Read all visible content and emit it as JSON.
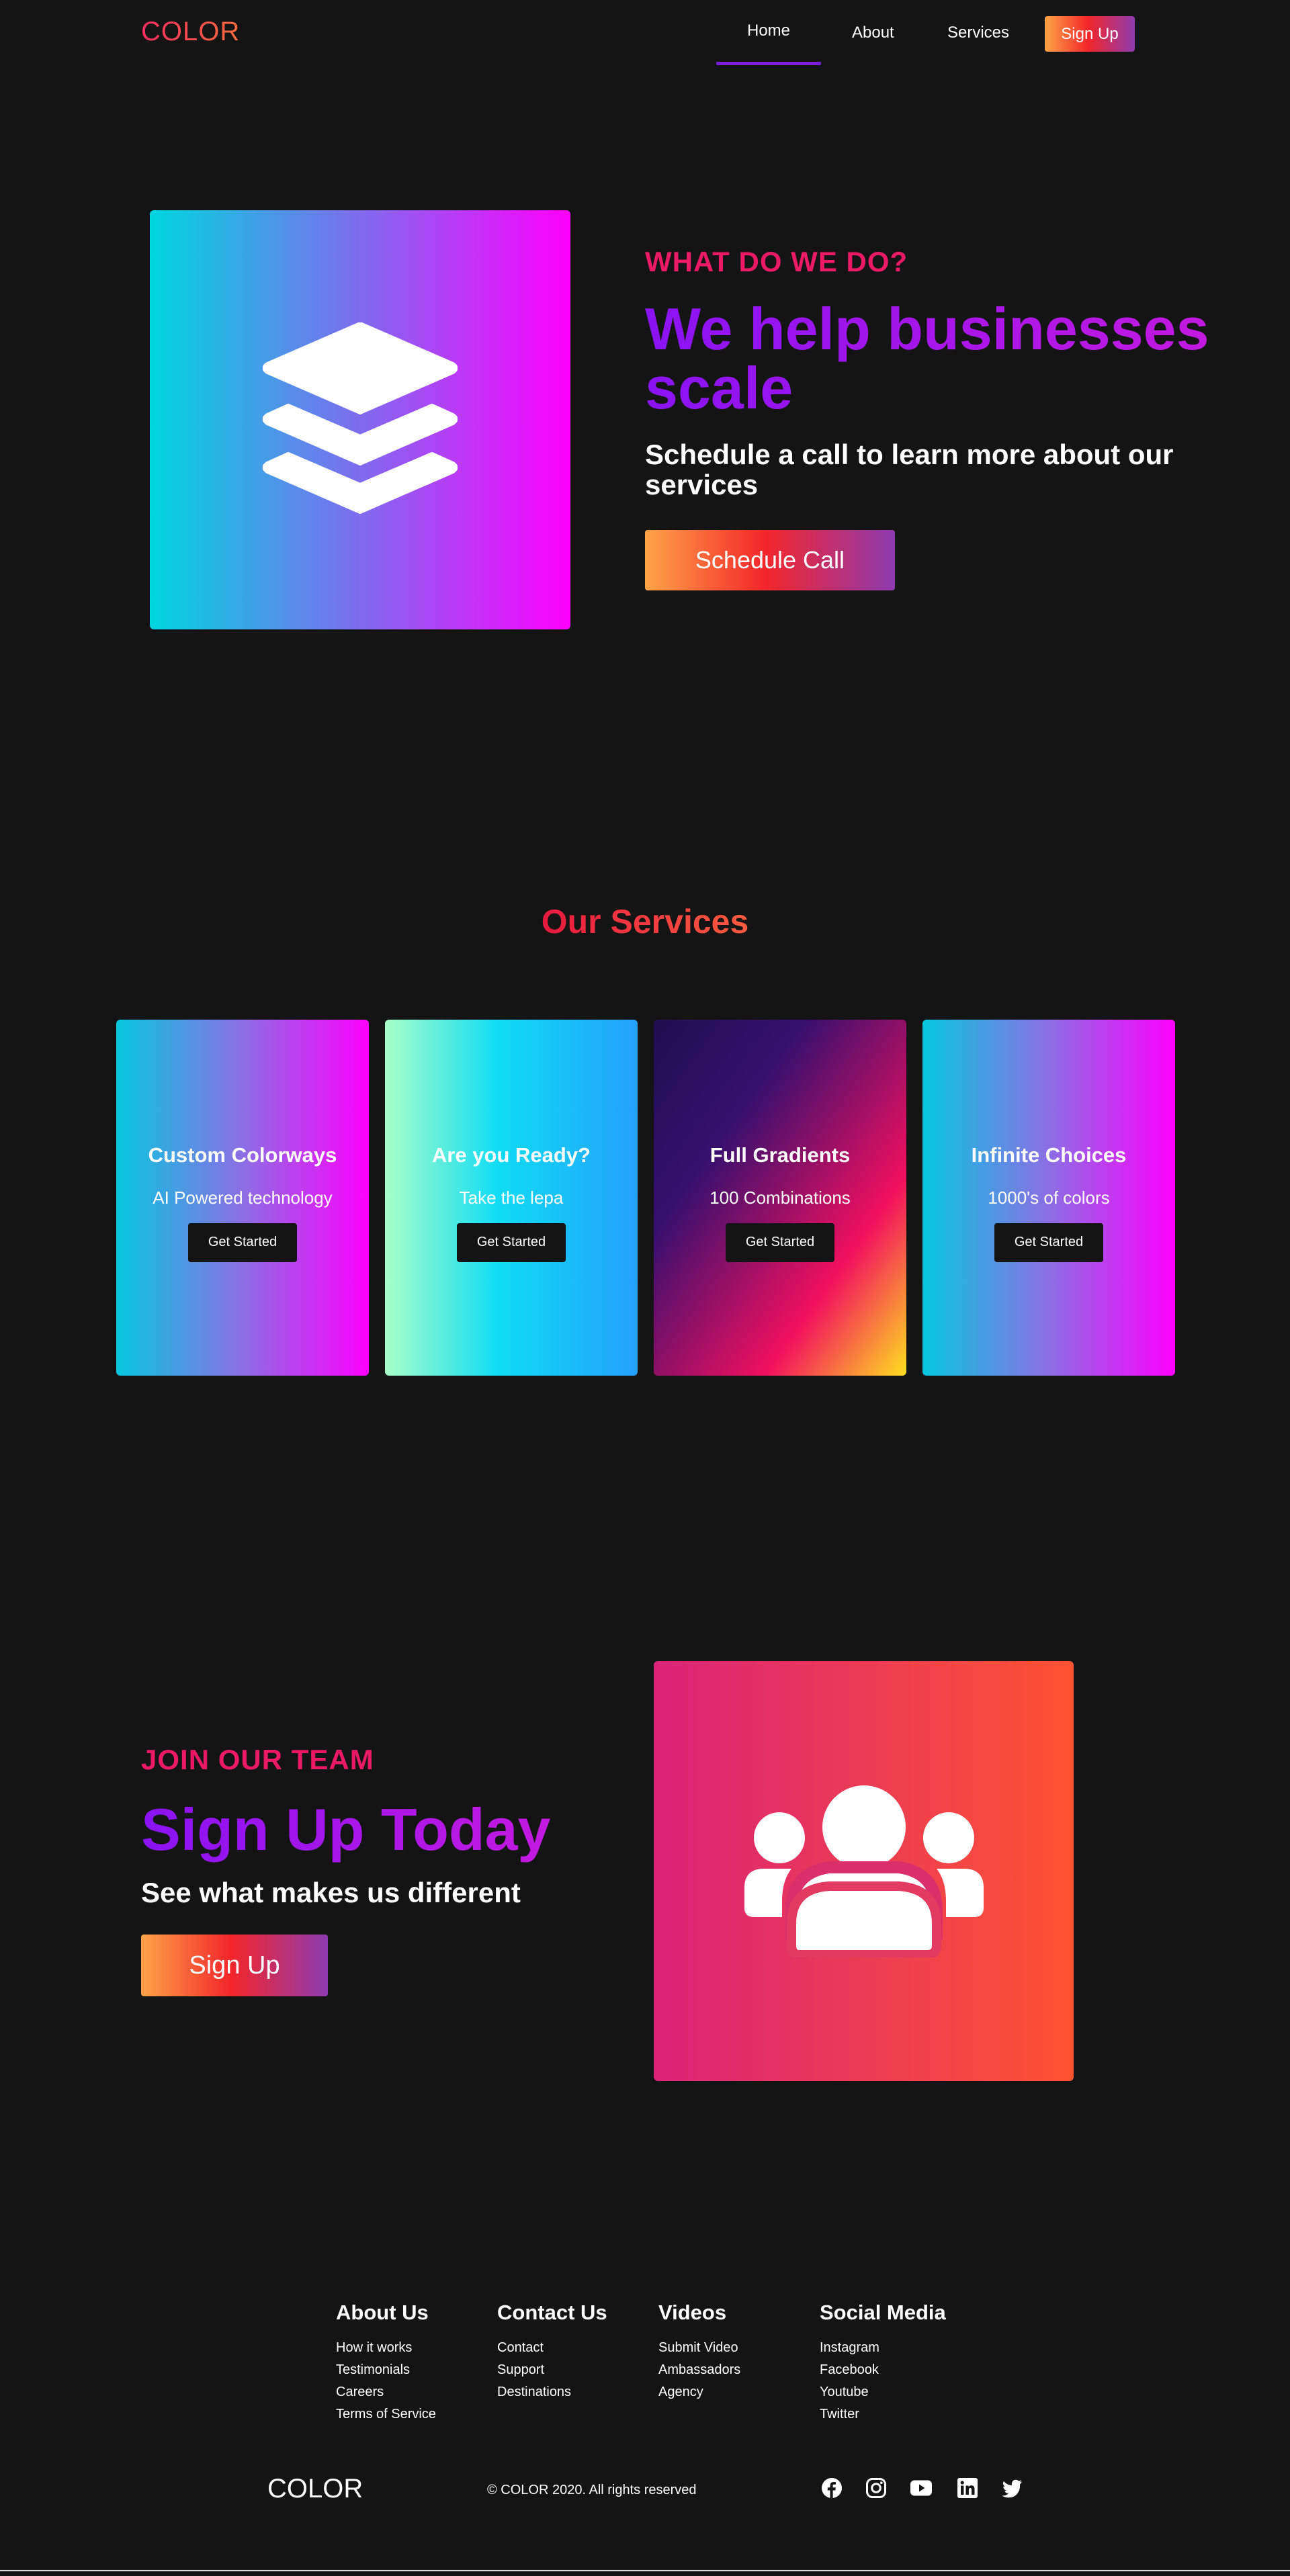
{
  "nav": {
    "logo": "COLOR",
    "links": [
      {
        "label": "Home"
      },
      {
        "label": "About"
      },
      {
        "label": "Services"
      }
    ],
    "signup_label": "Sign Up"
  },
  "hero": {
    "eyebrow": "WHAT DO WE DO?",
    "title": "We help businesses scale",
    "subtitle": "Schedule a call to learn more about our services",
    "button_label": "Schedule Call",
    "icon": "layers-icon"
  },
  "services": {
    "heading": "Our Services",
    "cards": [
      {
        "title": "Custom Colorways",
        "text": "AI Powered technology",
        "button": "Get Started"
      },
      {
        "title": "Are you Ready?",
        "text": "Take the lepa",
        "button": "Get Started"
      },
      {
        "title": "Full Gradients",
        "text": "100 Combinations",
        "button": "Get Started"
      },
      {
        "title": "Infinite Choices",
        "text": "1000's of colors",
        "button": "Get Started"
      }
    ]
  },
  "join": {
    "eyebrow": "JOIN OUR TEAM",
    "title": "Sign Up Today",
    "subtitle": "See what makes us different",
    "button_label": "Sign Up",
    "icon": "users-icon"
  },
  "footer": {
    "columns": [
      {
        "heading": "About Us",
        "links": [
          "How it works",
          "Testimonials",
          "Careers",
          "Terms of Service"
        ]
      },
      {
        "heading": "Contact Us",
        "links": [
          "Contact",
          "Support",
          "Destinations"
        ]
      },
      {
        "heading": "Videos",
        "links": [
          "Submit Video",
          "Ambassadors",
          "Agency"
        ]
      },
      {
        "heading": "Social Media",
        "links": [
          "Instagram",
          "Facebook",
          "Youtube",
          "Twitter"
        ]
      }
    ],
    "logo": "COLOR",
    "copyright": "© COLOR 2020. All rights reserved",
    "social_icons": [
      "facebook-icon",
      "instagram-icon",
      "youtube-icon",
      "linkedin-icon",
      "twitter-icon"
    ]
  },
  "colors": {
    "background": "#141414",
    "accent_pink": "#ec1965",
    "accent_purple": "#8a13f3",
    "nav_underline": "#7b1fdc"
  }
}
